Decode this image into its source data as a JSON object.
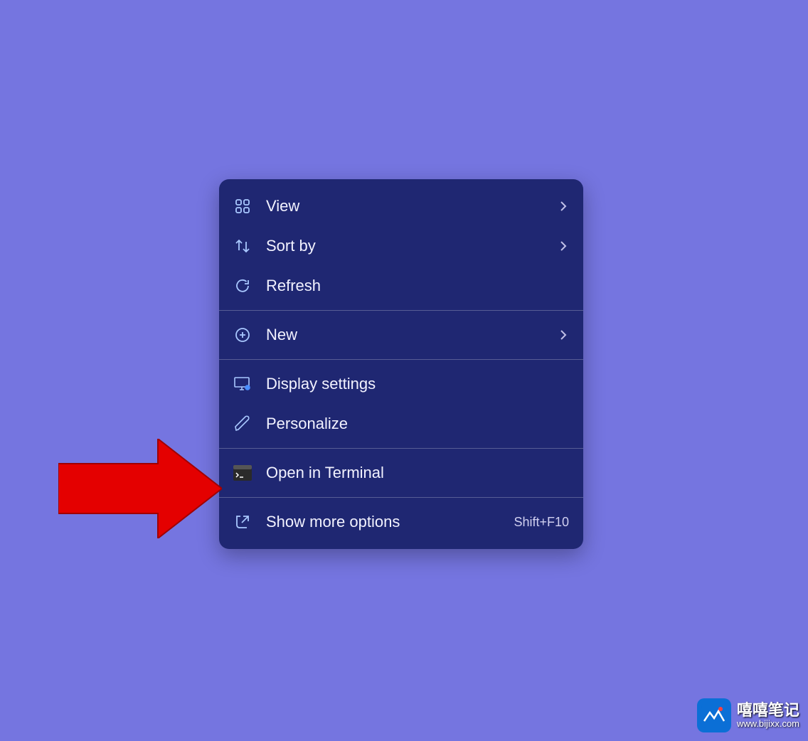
{
  "menu": {
    "items": [
      {
        "label": "View",
        "icon": "grid-icon",
        "submenu": true
      },
      {
        "label": "Sort by",
        "icon": "sort-icon",
        "submenu": true
      },
      {
        "label": "Refresh",
        "icon": "refresh-icon",
        "submenu": false
      }
    ],
    "items2": [
      {
        "label": "New",
        "icon": "plus-circle-icon",
        "submenu": true
      }
    ],
    "items3": [
      {
        "label": "Display settings",
        "icon": "display-settings-icon",
        "submenu": false
      },
      {
        "label": "Personalize",
        "icon": "pen-icon",
        "submenu": false
      }
    ],
    "items4": [
      {
        "label": "Open in Terminal",
        "icon": "terminal-icon",
        "submenu": false
      }
    ],
    "items5": [
      {
        "label": "Show more options",
        "icon": "expand-icon",
        "submenu": false,
        "shortcut": "Shift+F10"
      }
    ]
  },
  "watermark": {
    "line1": "嘻嘻笔记",
    "line2": "www.bijixx.com"
  },
  "colors": {
    "background": "#7575e0",
    "menu_bg": "#1f2772",
    "arrow": "#e40000"
  }
}
